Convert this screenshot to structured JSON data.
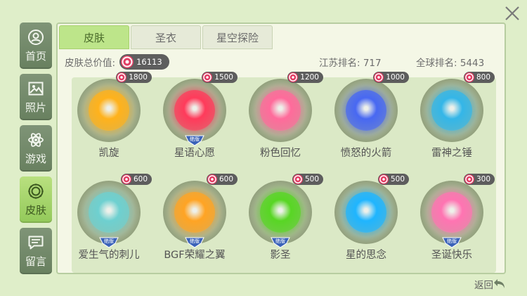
{
  "header": {
    "tabs": [
      "皮肤",
      "圣衣",
      "星空探险"
    ],
    "skin_total_label": "皮肤总价值:",
    "skin_total_value": "16113",
    "jiangsu_rank": "江苏排名: 717",
    "global_rank": "全球排名: 5443"
  },
  "sidebar": {
    "items": [
      {
        "label": "首页",
        "icon": "profile-icon"
      },
      {
        "label": "照片",
        "icon": "photo-icon"
      },
      {
        "label": "游戏",
        "icon": "atom-icon"
      },
      {
        "label": "皮肤",
        "icon": "skin-ring-icon"
      },
      {
        "label": "留言",
        "icon": "message-icon"
      }
    ],
    "active_index": 3
  },
  "skins": [
    {
      "name": "凯旋",
      "price": "1800",
      "limited": false,
      "color": "#ffb21c"
    },
    {
      "name": "星语心愿",
      "price": "1500",
      "limited": true,
      "color": "#ff3b5b"
    },
    {
      "name": "粉色回忆",
      "price": "1200",
      "limited": false,
      "color": "#ff6b9b"
    },
    {
      "name": "愤怒的火箭",
      "price": "1000",
      "limited": false,
      "color": "#4868f2"
    },
    {
      "name": "雷神之锤",
      "price": "800",
      "limited": false,
      "color": "#34b6e8"
    },
    {
      "name": "爱生气的刺儿",
      "price": "600",
      "limited": true,
      "color": "#6ed0d0"
    },
    {
      "name": "BGF荣耀之翼",
      "price": "600",
      "limited": true,
      "color": "#ffa424"
    },
    {
      "name": "影圣",
      "price": "500",
      "limited": true,
      "color": "#58d624"
    },
    {
      "name": "星的思念",
      "price": "500",
      "limited": false,
      "color": "#1fb5ff"
    },
    {
      "name": "圣诞快乐",
      "price": "300",
      "limited": true,
      "color": "#ff74b2"
    }
  ],
  "limited_label": "绝版",
  "back_label": "返回"
}
